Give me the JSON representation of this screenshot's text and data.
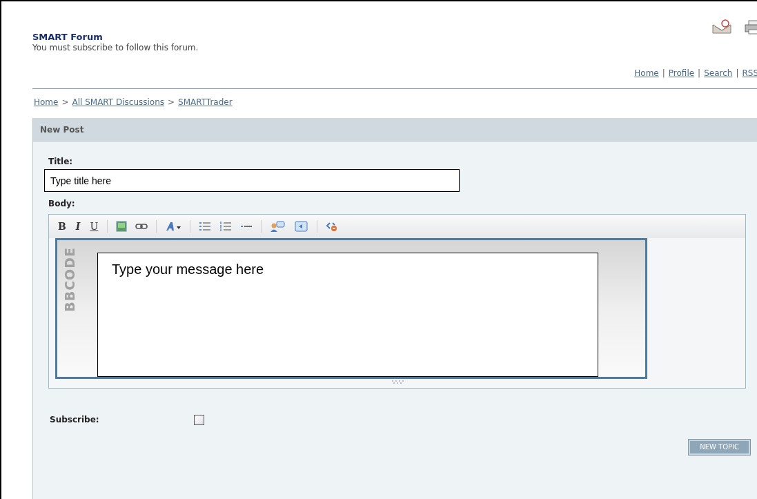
{
  "header": {
    "forum_title": "SMART Forum",
    "subtitle": "You must subscribe to follow this forum."
  },
  "top_links": [
    "Home",
    "Profile",
    "Search",
    "RSS"
  ],
  "top_links_separator": "|",
  "breadcrumb": [
    "Home",
    "All SMART Discussions",
    "SMARTTrader"
  ],
  "breadcrumb_separator": ">",
  "panel": {
    "title": "New Post"
  },
  "form": {
    "title_label": "Title:",
    "title_value": "Type title here",
    "body_label": "Body:",
    "toolbar_format": [
      "B",
      "I",
      "U"
    ],
    "editor_side_label": "BBCODE",
    "body_value": "Type your message here",
    "subscribe_label": "Subscribe:",
    "subscribe_checked": false,
    "submit": "NEW TOPIC"
  }
}
